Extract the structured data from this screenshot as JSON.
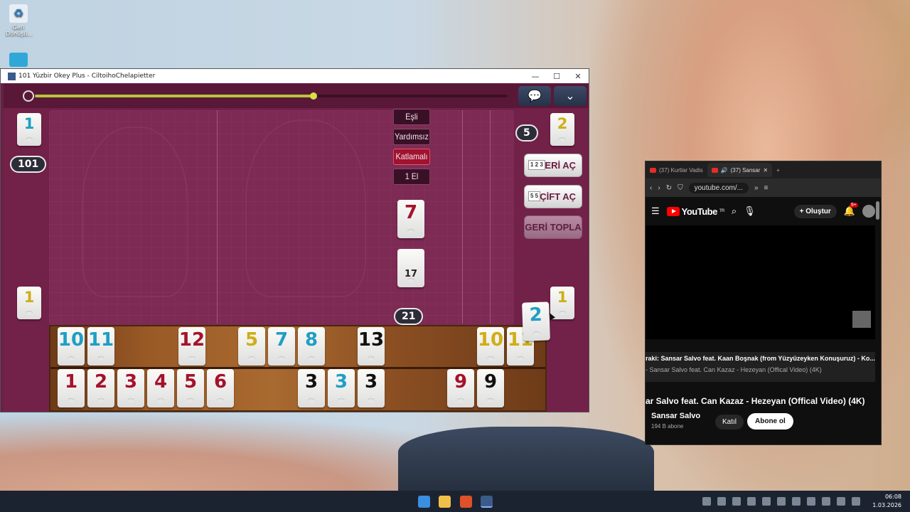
{
  "desktop": {
    "icons": [
      {
        "label": "Geri Dönüşü..."
      }
    ]
  },
  "game_window": {
    "title": "101 Yüzbir Okey Plus - CiltoihoChelapietter",
    "controls": {
      "minimize": "—",
      "maximize": "☐",
      "close": "✕"
    },
    "timer_progress": 0.59,
    "modes": [
      "Eşli",
      "Yardımsız",
      "Katlamalı",
      "1 El"
    ],
    "active_mode": "Katlamalı",
    "score_badge": "101",
    "opponent_count": "5",
    "center_indicator": "7",
    "center_stack_count": "17",
    "remaining_tiles": "21",
    "side_tiles": {
      "top_left": {
        "number": "1",
        "color": "blue"
      },
      "top_right": {
        "number": "2",
        "color": "yellow"
      },
      "bottom_left": {
        "number": "1",
        "color": "yellow"
      },
      "bottom_right": {
        "number": "1",
        "color": "yellow"
      },
      "dragging": {
        "number": "2",
        "color": "blue"
      }
    },
    "actions": {
      "seri_ac": {
        "label": "SERİ AÇ",
        "mini": "1 2 3"
      },
      "cift_ac": {
        "label": "ÇİFT AÇ",
        "mini": "5 5"
      },
      "geri_topla": {
        "label": "GERİ TOPLA"
      }
    },
    "rack_top": [
      {
        "number": "10",
        "color": "blue"
      },
      {
        "number": "11",
        "color": "blue"
      },
      {
        "number": "12",
        "color": "red"
      },
      {
        "number": "5",
        "color": "yellow"
      },
      {
        "number": "7",
        "color": "blue"
      },
      {
        "number": "8",
        "color": "blue"
      },
      {
        "number": "13",
        "color": "black"
      },
      {
        "number": "10",
        "color": "yellow"
      },
      {
        "number": "11",
        "color": "yellow"
      }
    ],
    "rack_bottom": [
      {
        "number": "1",
        "color": "red"
      },
      {
        "number": "2",
        "color": "red"
      },
      {
        "number": "3",
        "color": "red"
      },
      {
        "number": "4",
        "color": "red"
      },
      {
        "number": "5",
        "color": "red"
      },
      {
        "number": "6",
        "color": "red"
      },
      {
        "number": "3",
        "color": "black"
      },
      {
        "number": "3",
        "color": "blue"
      },
      {
        "number": "3",
        "color": "black"
      },
      {
        "number": "9",
        "color": "red"
      },
      {
        "number": "9",
        "color": "black"
      }
    ]
  },
  "browser": {
    "tabs": [
      {
        "label": "(37) Kurtlar Vadis"
      },
      {
        "label": "(37) Sansar"
      }
    ],
    "new_tab": "+",
    "url": "youtube.com/...",
    "logo": "YouTube",
    "logo_region": "TR",
    "create_label": "Oluştur",
    "notifications": "9+",
    "queue": [
      "raki: Sansar Salvo feat. Kaan Boşnak (from Yüzyüzeyken Konuşuruz) - Ko...",
      "- Sansar Salvo feat. Can Kazaz - Hezeyan (Offical Video) (4K)"
    ],
    "video_title": "ar Salvo feat. Can Kazaz - Hezeyan (Offical Video) (4K)",
    "channel": "Sansar Salvo",
    "subscribers": "194 B abone",
    "join_label": "Katıl",
    "subscribe_label": "Abone ol"
  },
  "taskbar": {
    "time": "06:08",
    "date": "1.03.2026"
  },
  "colors": {
    "blue": "#1f9fc4",
    "red": "#a5122b",
    "black": "#111111",
    "yellow": "#cfae17",
    "table": "#722149",
    "active_mode": "#a0122e"
  }
}
